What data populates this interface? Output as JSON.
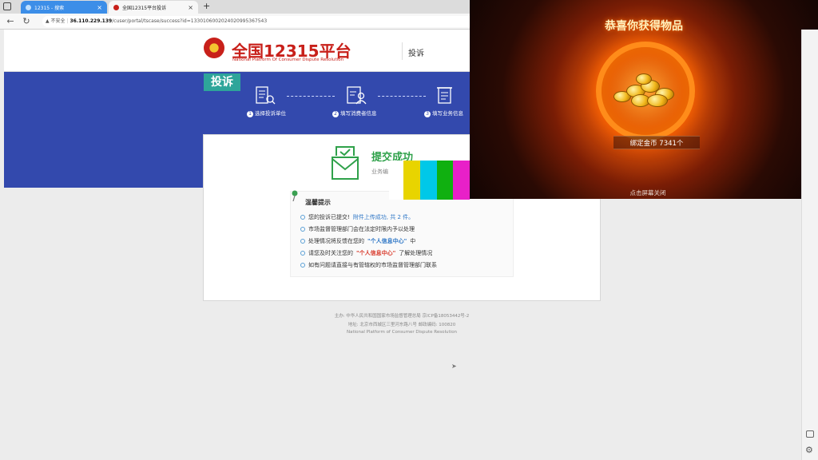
{
  "browser": {
    "tabs": [
      {
        "title": "12315 - 搜索",
        "close": "×"
      },
      {
        "title": "全国12315平台投诉",
        "close": "×"
      }
    ],
    "new_tab": "+",
    "security_label": "不安全",
    "url_host": "36.110.229.139",
    "url_path": "/cuser/portal/tscase/success?id=13301060020240209953675​43",
    "colors": {
      "tab_active": "#f7f7f7",
      "tab_inactive": "#3c8ee8",
      "accent": "#3349ad"
    }
  },
  "site": {
    "title": "全国12315平台",
    "subtitle": "National Platform Of Consumer Dispute Resolution",
    "nav_item": "投诉",
    "badge": "投诉",
    "steps": [
      {
        "num": "1",
        "label": "选择投诉单位",
        "icon": "building-search-icon"
      },
      {
        "num": "2",
        "label": "填写消费者信息",
        "icon": "person-form-icon"
      },
      {
        "num": "3",
        "label": "填写业务信息",
        "icon": "document-scroll-icon"
      }
    ]
  },
  "result": {
    "title": "提交成功",
    "subtitle": "业务编",
    "tips_title": "温馨提示",
    "tips": [
      {
        "text": "您的投诉已提交!",
        "highlight": "附件上传成功, 共 2 件。",
        "suffix": ""
      },
      {
        "text": "市场监督管理部门会在法定时限内予以处理",
        "highlight": "",
        "suffix": ""
      },
      {
        "text": "处理情况将反馈在您的",
        "highlight": "\"个人信息中心\"",
        "suffix": "中"
      },
      {
        "text": "请您及时关注您的",
        "highlight": "\"个人信息中心\"",
        "suffix": "了解处理情况"
      },
      {
        "text": "如有问题请直接与有管辖权的市场监督管理部门联系",
        "highlight": "",
        "suffix": ""
      }
    ]
  },
  "footer": {
    "line1": "主办: 中华人民共和国国家市场监督管理总局 京ICP备18053442号-2",
    "line2": "地址: 北京市西城区三里河东路八号 邮政编码: 100820",
    "line3": "National Platform of Consumer Dispute Resolution"
  },
  "overlay": {
    "title": "恭喜你获得物品",
    "reward": "绑定金币 7341个",
    "hint": "点击屏幕关闭",
    "colors": {
      "title": "#fff3c0",
      "glow": "#ff6a00"
    }
  }
}
